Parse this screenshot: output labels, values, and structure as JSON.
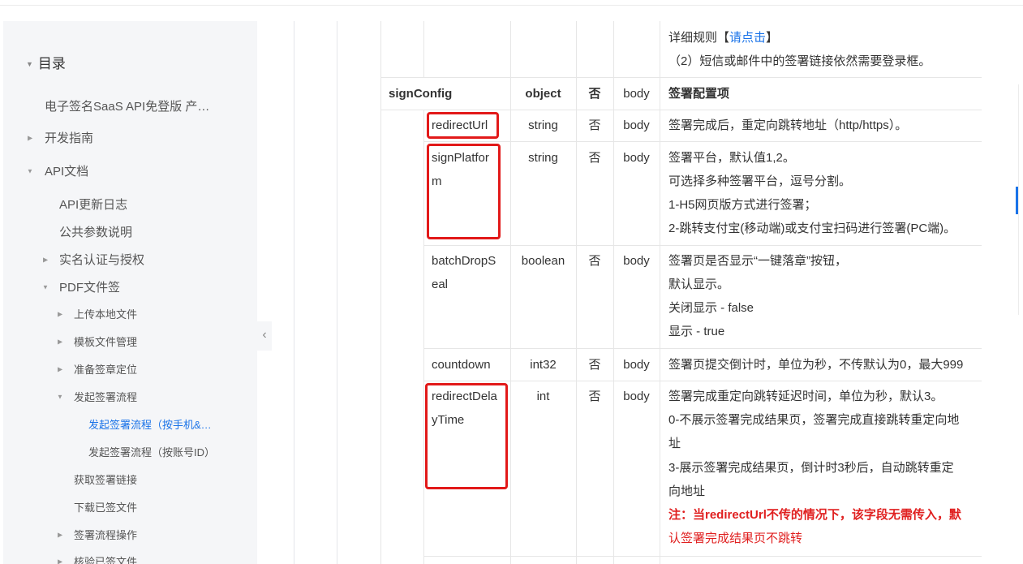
{
  "sidebar": {
    "title": "目录",
    "items": [
      {
        "label": "电子签名SaaS API免登版 产…"
      },
      {
        "label": "开发指南"
      },
      {
        "label": "API文档"
      },
      {
        "label": "API更新日志"
      },
      {
        "label": "公共参数说明"
      },
      {
        "label": "实名认证与授权"
      },
      {
        "label": "PDF文件签"
      },
      {
        "label": "上传本地文件"
      },
      {
        "label": "模板文件管理"
      },
      {
        "label": "准备签章定位"
      },
      {
        "label": "发起签署流程"
      },
      {
        "label": "发起签署流程（按手机&…"
      },
      {
        "label": "发起签署流程（按账号ID）"
      },
      {
        "label": "获取签署链接"
      },
      {
        "label": "下载已签文件"
      },
      {
        "label": "签署流程操作"
      },
      {
        "label": "核验已签文件"
      }
    ],
    "collapse_icon": "chevron-left-icon"
  },
  "table": {
    "top_desc": {
      "line1_prefix": "详细规则【",
      "line1_link": "请点击",
      "line1_suffix": "】",
      "line2": "（2）短信或邮件中的签署链接依然需要登录框。"
    },
    "rows": [
      {
        "name": "signConfig",
        "type": "object",
        "required": "否",
        "position": "body",
        "desc": [
          "签署配置项"
        ]
      },
      {
        "name": "redirectUrl",
        "type": "string",
        "required": "否",
        "position": "body",
        "desc": [
          "签署完成后，重定向跳转地址（http/https）。"
        ]
      },
      {
        "name_lines": [
          "signPlatfor",
          "m"
        ],
        "type": "string",
        "required": "否",
        "position": "body",
        "desc": [
          "签署平台，默认值1,2。",
          "可选择多种签署平台，逗号分割。",
          "1-H5网页版方式进行签署；",
          "2-跳转支付宝(移动端)或支付宝扫码进行签署(PC端)。"
        ]
      },
      {
        "name_lines": [
          "batchDropS",
          "eal"
        ],
        "type": "boolean",
        "required": "否",
        "position": "body",
        "desc": [
          "签署页是否显示“一键落章”按钮，",
          "默认显示。",
          "关闭显示 - false",
          "显示 - true"
        ]
      },
      {
        "name": "countdown",
        "type": "int32",
        "required": "否",
        "position": "body",
        "desc": [
          "签署页提交倒计时，单位为秒，不传默认为0，最大999"
        ]
      },
      {
        "name_lines": [
          "redirectDela",
          "yTime"
        ],
        "type": "int",
        "required": "否",
        "position": "body",
        "desc": [
          "签署完成重定向跳转延迟时间，单位为秒，默认3。",
          "0-不展示签署完成结果页，签署完成直接跳转重定向地",
          "址",
          "3-展示签署完成结果页，倒计时3秒后，自动跳转重定",
          "向地址"
        ],
        "note_lines": [
          "注：当redirectUrl不传的情况下，该字段无需传入，默",
          "认签署完成结果页不跳转"
        ]
      }
    ]
  },
  "colors": {
    "accent": "#1a73e8",
    "highlight_box": "#e21919",
    "note_text": "#e02020"
  }
}
